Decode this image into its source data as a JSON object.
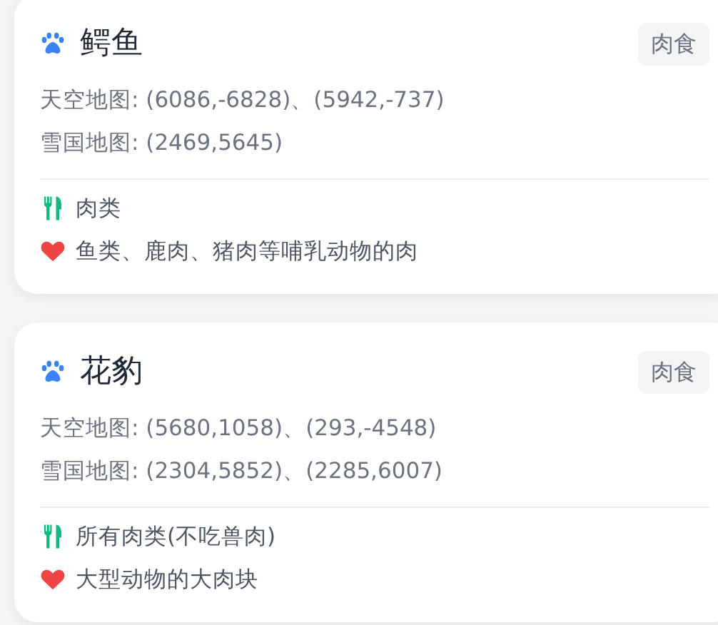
{
  "animals": [
    {
      "name": "鳄鱼",
      "tag": "肉食",
      "locations": [
        "天空地图: (6086,-6828)、(5942,-737)",
        "雪国地图: (2469,5645)"
      ],
      "food": "肉类",
      "favorite": "鱼类、鹿肉、猪肉等哺乳动物的肉"
    },
    {
      "name": "花豹",
      "tag": "肉食",
      "locations": [
        "天空地图: (5680,1058)、(293,-4548)",
        "雪国地图: (2304,5852)、(2285,6007)"
      ],
      "food": "所有肉类(不吃兽肉)",
      "favorite": "大型动物的大肉块"
    }
  ]
}
